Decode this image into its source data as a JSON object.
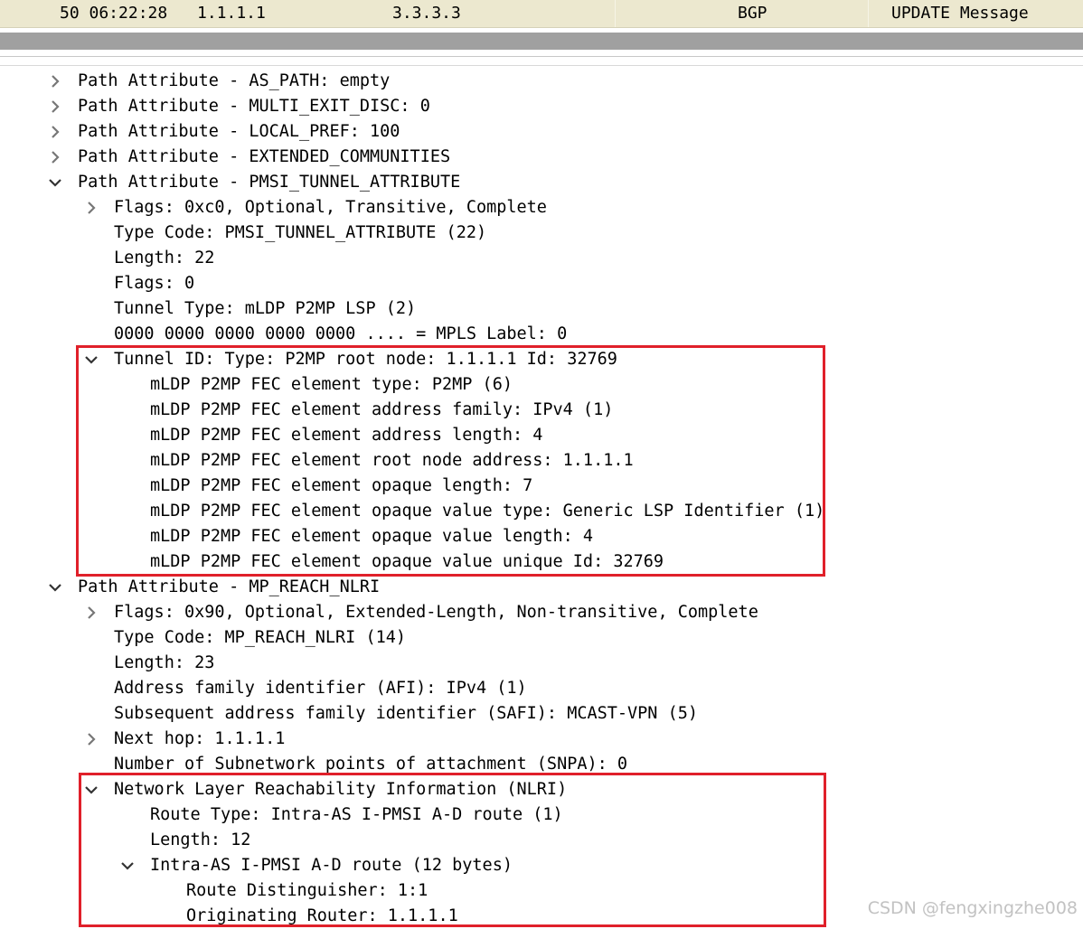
{
  "packet_row": {
    "number_time": "50 06:22:28",
    "source": "1.1.1.1",
    "destination": "3.3.3.3",
    "protocol": "BGP",
    "info": "UPDATE Message"
  },
  "tree": [
    {
      "text": "Path Attribute - AS_PATH: empty",
      "depth": 0,
      "toggle": "collapsed"
    },
    {
      "text": "Path Attribute - MULTI_EXIT_DISC: 0",
      "depth": 0,
      "toggle": "collapsed"
    },
    {
      "text": "Path Attribute - LOCAL_PREF: 100",
      "depth": 0,
      "toggle": "collapsed"
    },
    {
      "text": "Path Attribute - EXTENDED_COMMUNITIES",
      "depth": 0,
      "toggle": "collapsed"
    },
    {
      "text": "Path Attribute - PMSI_TUNNEL_ATTRIBUTE",
      "depth": 0,
      "toggle": "expanded"
    },
    {
      "text": "Flags: 0xc0, Optional, Transitive, Complete",
      "depth": 1,
      "toggle": "collapsed"
    },
    {
      "text": "Type Code: PMSI_TUNNEL_ATTRIBUTE (22)",
      "depth": 1,
      "toggle": "none"
    },
    {
      "text": "Length: 22",
      "depth": 1,
      "toggle": "none"
    },
    {
      "text": "Flags: 0",
      "depth": 1,
      "toggle": "none"
    },
    {
      "text": "Tunnel Type: mLDP P2MP LSP (2)",
      "depth": 1,
      "toggle": "none"
    },
    {
      "text": "0000 0000 0000 0000 0000 .... = MPLS Label: 0",
      "depth": 1,
      "toggle": "none"
    },
    {
      "text": "Tunnel ID: Type: P2MP root node: 1.1.1.1 Id: 32769",
      "depth": 1,
      "toggle": "expanded"
    },
    {
      "text": "mLDP P2MP FEC element type: P2MP (6)",
      "depth": 2,
      "toggle": "none"
    },
    {
      "text": "mLDP P2MP FEC element address family: IPv4 (1)",
      "depth": 2,
      "toggle": "none"
    },
    {
      "text": "mLDP P2MP FEC element address length: 4",
      "depth": 2,
      "toggle": "none"
    },
    {
      "text": "mLDP P2MP FEC element root node address: 1.1.1.1",
      "depth": 2,
      "toggle": "none"
    },
    {
      "text": "mLDP P2MP FEC element opaque length: 7",
      "depth": 2,
      "toggle": "none"
    },
    {
      "text": "mLDP P2MP FEC element opaque value type: Generic LSP Identifier (1)",
      "depth": 2,
      "toggle": "none"
    },
    {
      "text": "mLDP P2MP FEC element opaque value length: 4",
      "depth": 2,
      "toggle": "none"
    },
    {
      "text": "mLDP P2MP FEC element opaque value unique Id: 32769",
      "depth": 2,
      "toggle": "none"
    },
    {
      "text": "Path Attribute - MP_REACH_NLRI",
      "depth": 0,
      "toggle": "expanded"
    },
    {
      "text": "Flags: 0x90, Optional, Extended-Length, Non-transitive, Complete",
      "depth": 1,
      "toggle": "collapsed"
    },
    {
      "text": "Type Code: MP_REACH_NLRI (14)",
      "depth": 1,
      "toggle": "none"
    },
    {
      "text": "Length: 23",
      "depth": 1,
      "toggle": "none"
    },
    {
      "text": "Address family identifier (AFI): IPv4 (1)",
      "depth": 1,
      "toggle": "none"
    },
    {
      "text": "Subsequent address family identifier (SAFI): MCAST-VPN (5)",
      "depth": 1,
      "toggle": "none"
    },
    {
      "text": "Next hop: 1.1.1.1",
      "depth": 1,
      "toggle": "collapsed"
    },
    {
      "text": "Number of Subnetwork points of attachment (SNPA): 0",
      "depth": 1,
      "toggle": "none"
    },
    {
      "text": "Network Layer Reachability Information (NLRI)",
      "depth": 1,
      "toggle": "expanded"
    },
    {
      "text": "Route Type: Intra-AS I-PMSI A-D route (1)",
      "depth": 2,
      "toggle": "none"
    },
    {
      "text": "Length: 12",
      "depth": 2,
      "toggle": "none"
    },
    {
      "text": "Intra-AS I-PMSI A-D route (12 bytes)",
      "depth": 2,
      "toggle": "expanded"
    },
    {
      "text": "Route Distinguisher: 1:1",
      "depth": 3,
      "toggle": "none"
    },
    {
      "text": "Originating Router: 1.1.1.1",
      "depth": 3,
      "toggle": "none"
    }
  ],
  "highlight_color": "#e0202a",
  "watermark": "CSDN @fengxingzhe008"
}
